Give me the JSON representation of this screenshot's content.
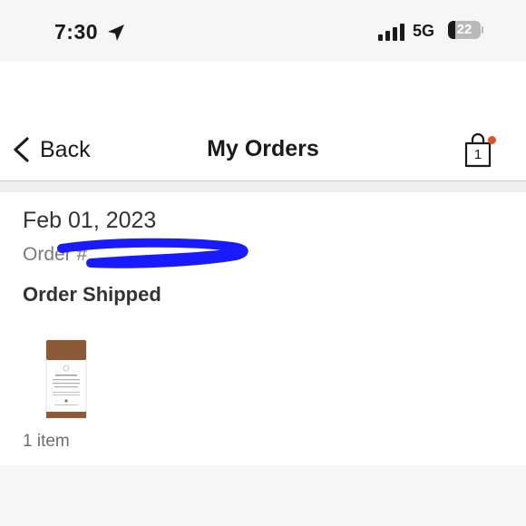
{
  "status_bar": {
    "time": "7:30",
    "network": "5G",
    "battery_level": "22",
    "battery_fraction": 0.22,
    "icons": [
      "location-arrow-icon",
      "cellular-signal-icon",
      "battery-icon"
    ]
  },
  "nav": {
    "back_label": "Back",
    "title": "My Orders",
    "cart_count": "1",
    "icons": [
      "chevron-left-icon",
      "shopping-bag-icon"
    ],
    "badge_color": "#e0522a"
  },
  "order": {
    "date": "Feb 01, 2023",
    "number_prefix": "Order #",
    "status": "Order Shipped",
    "item_count": "1 item",
    "redaction_color": "#1a1aff"
  }
}
